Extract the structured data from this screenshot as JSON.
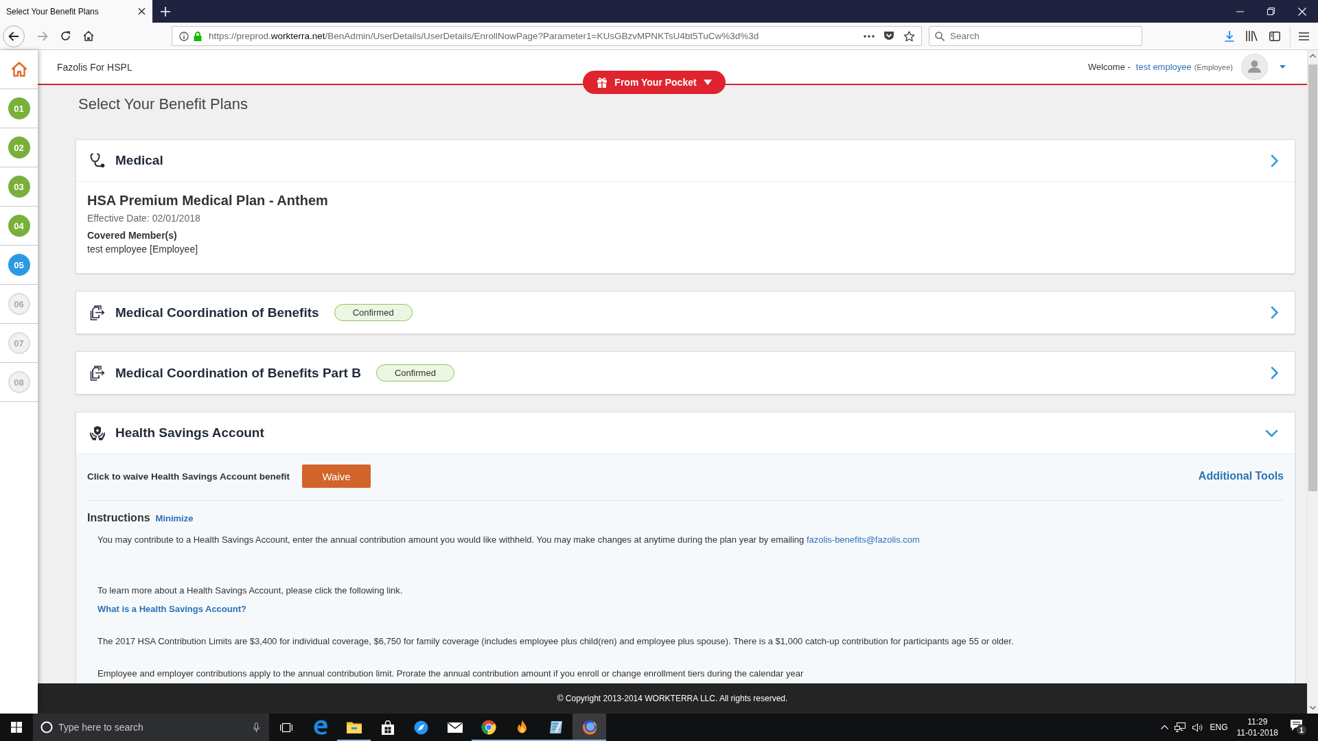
{
  "browser": {
    "tab": {
      "title": "Select Your Benefit Plans",
      "selected": true
    },
    "nav_buttons": [
      {
        "kind": "back",
        "disabled": false
      },
      {
        "kind": "forward",
        "disabled": true
      },
      {
        "kind": "reload",
        "disabled": false
      },
      {
        "kind": "home",
        "disabled": false
      }
    ],
    "url": "https://preprod.**workterra.net**/BenAdmin/UserDetails/UserDetails/EnrollNowPage?Parameter1=KUsGBzvMPNKTsU4bt5TuCw%3d%3d",
    "search": {
      "placeholder": "Search"
    }
  },
  "sidebar": {
    "steps": [
      {
        "label": "01",
        "completed": true,
        "selected": false
      },
      {
        "label": "02",
        "completed": true,
        "selected": false
      },
      {
        "label": "03",
        "completed": true,
        "selected": false
      },
      {
        "label": "04",
        "completed": true,
        "selected": false
      },
      {
        "label": "05",
        "completed": false,
        "selected": true
      },
      {
        "label": "06",
        "completed": false,
        "selected": false
      },
      {
        "label": "07",
        "completed": false,
        "selected": false
      },
      {
        "label": "08",
        "completed": false,
        "selected": false
      }
    ]
  },
  "header": {
    "company": "Fazolis For HSPL",
    "budget_button": "From Your Pocket",
    "welcome": "Welcome -",
    "user_name": "test employee",
    "user_role": "(Employee)"
  },
  "page_title": "Select Your Benefit Plans",
  "cards": [
    {
      "kind": "medical",
      "title": "Medical",
      "expanded": false,
      "plan": {
        "name": "HSA Premium Medical Plan - Anthem",
        "effective_date": "Effective Date: 02/01/2018",
        "covered_label": "Covered Member(s)",
        "covered_members": "test employee [Employee]"
      }
    },
    {
      "kind": "coordination",
      "title": "Medical Coordination of Benefits",
      "status": "Confirmed",
      "expanded": false
    },
    {
      "kind": "coordination",
      "title": "Medical Coordination of Benefits Part B",
      "status": "Confirmed",
      "expanded": false
    },
    {
      "kind": "hsa",
      "title": "Health Savings Account",
      "expanded": true,
      "details": {
        "waive_prompt": "Click to waive Health Savings Account benefit",
        "waive_button": "Waive",
        "tools_link": "Additional Tools",
        "instructions_title": "Instructions",
        "minimize_link": "Minimize",
        "instructions": [
          {
            "kind": "text",
            "text": "You may contribute to a Health Savings Account, enter the annual contribution amount you would like withheld. You may make changes at anytime during the plan year by emailing",
            "link": "fazolis-benefits@fazolis.com"
          },
          {
            "kind": "text",
            "text": "To learn more about a Health Savings Account, please click the following link."
          },
          {
            "kind": "link",
            "text": "What is a Health Savings Account?"
          },
          {
            "kind": "text",
            "text": "The 2017 HSA Contribution Limits are $3,400 for individual coverage, $6,750 for family coverage (includes employee plus child(ren) and employee plus spouse). There is a $1,000 catch-up contribution for participants age 55 or older."
          },
          {
            "kind": "text",
            "text": "Employee and employer contributions apply to the annual contribution limit. Prorate the annual contribution amount if you enroll or change enrollment tiers during the calendar year"
          }
        ]
      }
    }
  ],
  "footer": {
    "copyright": "© Copyright 2013-2014 WORKTERRA LLC. All rights reserved."
  },
  "taskbar": {
    "search": {
      "placeholder": "Type here to search"
    },
    "apps": [
      {
        "kind": "letter",
        "running": false,
        "selected": false
      },
      {
        "kind": "folder",
        "running": true,
        "selected": false
      },
      {
        "kind": "bag",
        "running": false,
        "selected": false
      },
      {
        "kind": "compass",
        "running": false,
        "selected": false
      },
      {
        "kind": "envelope",
        "running": false,
        "selected": false
      },
      {
        "kind": "wheel",
        "running": true,
        "selected": false
      },
      {
        "kind": "flame",
        "running": true,
        "selected": false
      },
      {
        "kind": "notes",
        "running": true,
        "selected": false
      },
      {
        "kind": "fox",
        "running": true,
        "selected": true
      }
    ],
    "language": "ENG",
    "time": "11:29",
    "date": "11-01-2018",
    "notification_count": "1"
  }
}
